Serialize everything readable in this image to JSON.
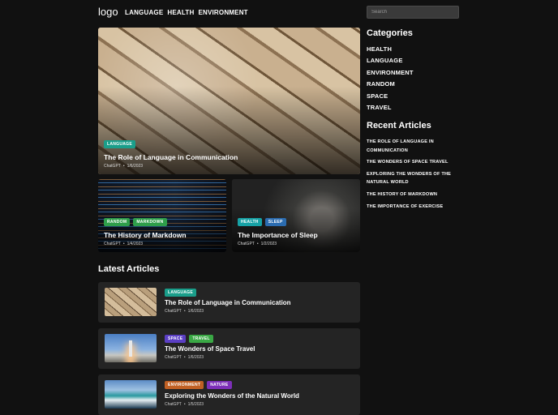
{
  "header": {
    "logo": "logo",
    "nav": [
      "LANGUAGE",
      "HEALTH",
      "ENVIRONMENT"
    ],
    "search_placeholder": "Search"
  },
  "colors": {
    "background": "#111111",
    "card": "#242424",
    "tag_language": "#1a9e8a",
    "tag_random": "#2e9d4a",
    "tag_markdown": "#2e9d4a",
    "tag_health": "#17a2a6",
    "tag_sleep": "#2b6cb0",
    "tag_space": "#5b3fc4",
    "tag_travel": "#3aa845",
    "tag_environment": "#c06024",
    "tag_nature": "#7d2fb8"
  },
  "featured": {
    "main": {
      "tags": [
        "LANGUAGE"
      ],
      "title": "The Role of Language in Communication",
      "author": "ChatGPT",
      "date": "1/6/2023"
    },
    "left": {
      "tags": [
        "RANDOM",
        "MARKDOWN"
      ],
      "title": "The History of Markdown",
      "author": "ChatGPT",
      "date": "1/4/2023"
    },
    "right": {
      "tags": [
        "HEALTH",
        "SLEEP"
      ],
      "title": "The Importance of Sleep",
      "author": "ChatGPT",
      "date": "1/2/2023"
    }
  },
  "latest": {
    "title": "Latest Articles",
    "items": [
      {
        "tags": [
          "LANGUAGE"
        ],
        "title": "The Role of Language in Communication",
        "author": "ChatGPT",
        "date": "1/6/2023"
      },
      {
        "tags": [
          "SPACE",
          "TRAVEL"
        ],
        "title": "The Wonders of Space Travel",
        "author": "ChatGPT",
        "date": "1/6/2023"
      },
      {
        "tags": [
          "ENVIRONMENT",
          "NATURE"
        ],
        "title": "Exploring the Wonders of the Natural World",
        "author": "ChatGPT",
        "date": "1/5/2023"
      }
    ]
  },
  "sidebar": {
    "categories_title": "Categories",
    "categories": [
      "HEALTH",
      "LANGUAGE",
      "ENVIRONMENT",
      "RANDOM",
      "SPACE",
      "TRAVEL"
    ],
    "recent_title": "Recent Articles",
    "recent": [
      "THE ROLE OF LANGUAGE IN COMMUNICATION",
      "THE WONDERS OF SPACE TRAVEL",
      "EXPLORING THE WONDERS OF THE NATURAL WORLD",
      "THE HISTORY OF MARKDOWN",
      "THE IMPORTANCE OF EXERCISE"
    ]
  }
}
